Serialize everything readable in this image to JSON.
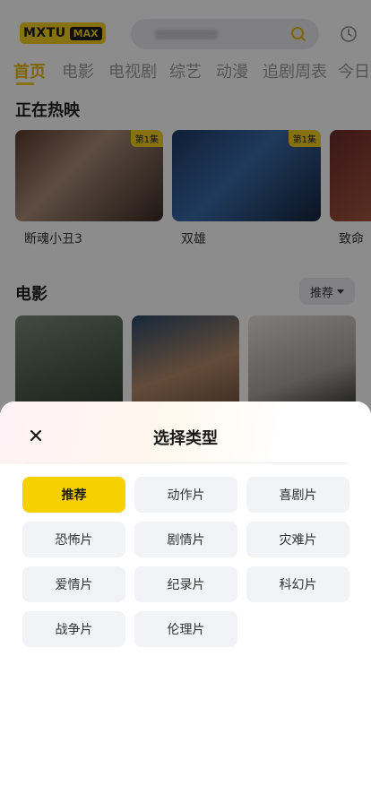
{
  "header": {
    "logo_text": "MXTU",
    "logo_badge": "MAX"
  },
  "nav_tabs": [
    "首页",
    "电影",
    "电视剧",
    "综艺",
    "动漫",
    "追剧周表",
    "今日"
  ],
  "now_showing": {
    "title": "正在热映",
    "cards": [
      {
        "title": "断魂小丑3",
        "badge": "第1集"
      },
      {
        "title": "双雄",
        "badge": "第1集"
      },
      {
        "title": "致命",
        "badge": ""
      }
    ]
  },
  "movies": {
    "title": "电影",
    "sort_label": "推荐"
  },
  "type_sheet": {
    "title": "选择类型",
    "selected": "推荐",
    "options": [
      "推荐",
      "动作片",
      "喜剧片",
      "恐怖片",
      "剧情片",
      "灾难片",
      "爱情片",
      "纪录片",
      "科幻片",
      "战争片",
      "伦理片"
    ]
  },
  "colors": {
    "accent": "#f7d000",
    "chip_bg": "#f2f3f7"
  }
}
